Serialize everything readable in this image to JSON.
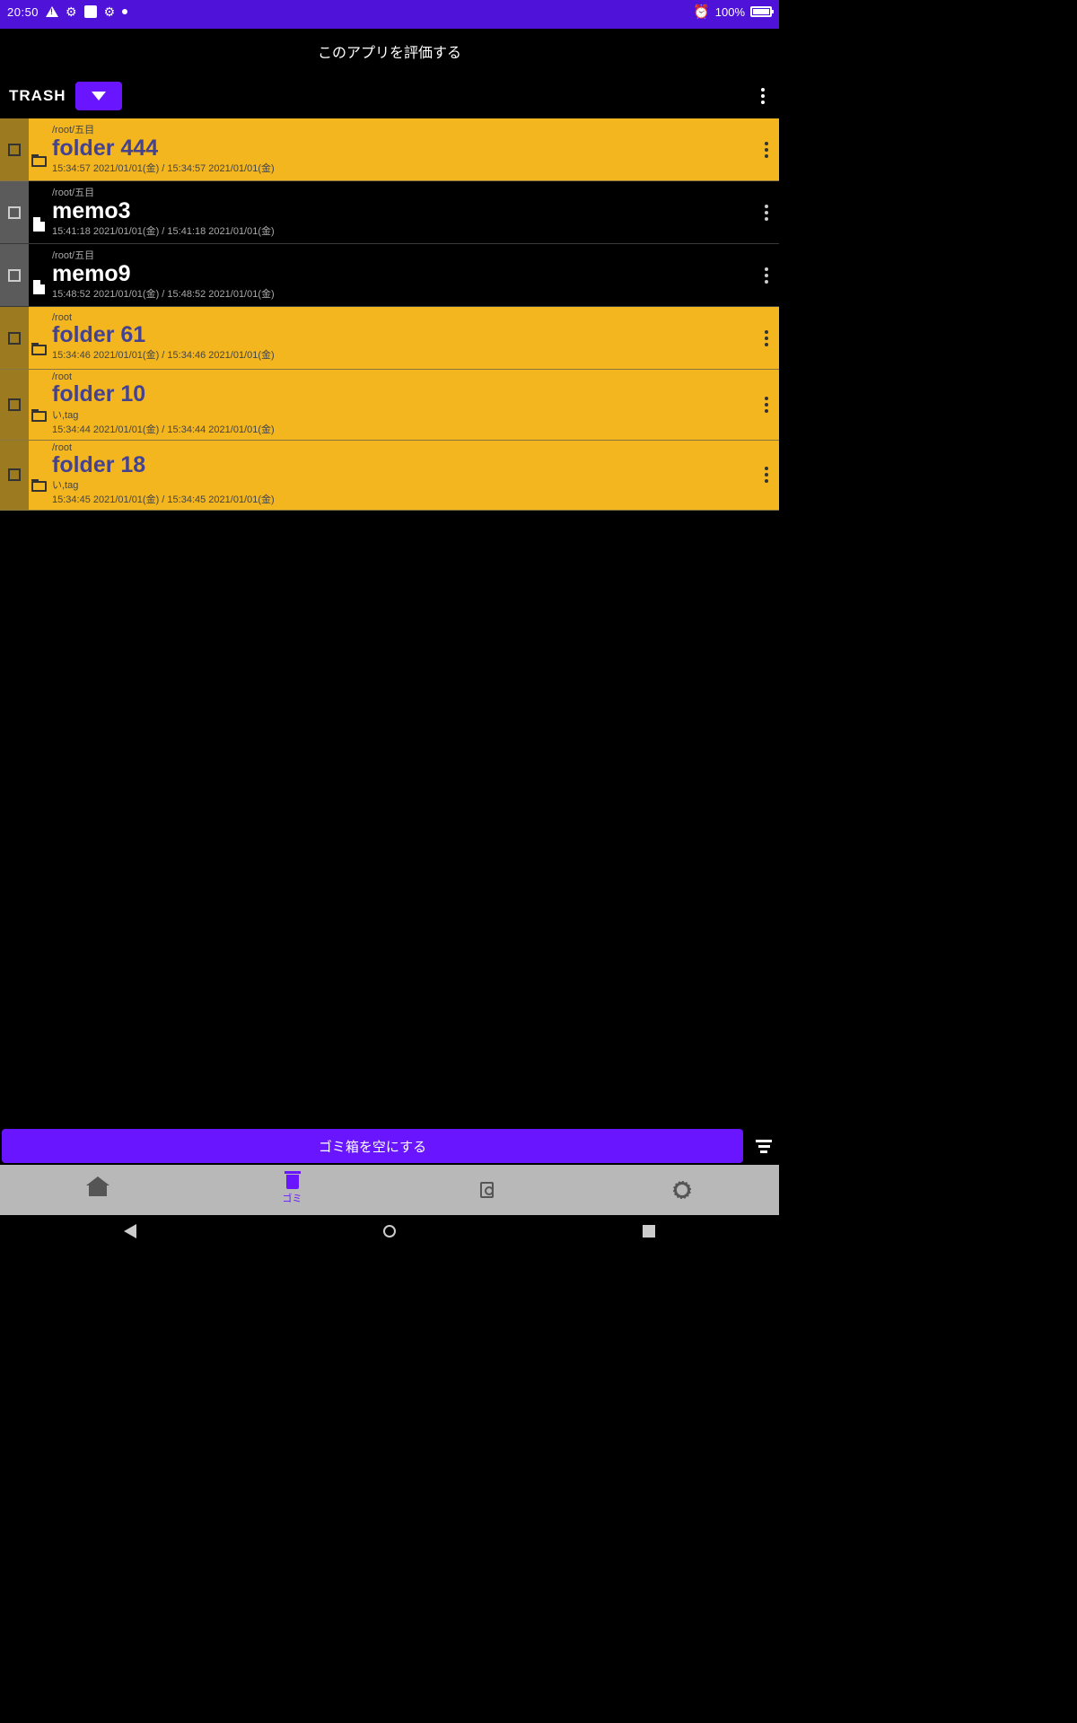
{
  "status": {
    "time": "20:50",
    "battery_pct": "100%"
  },
  "header": {
    "rate_label": "このアプリを評価する",
    "trash_label": "TRASH"
  },
  "items": [
    {
      "type": "folder",
      "path": "/root/五目",
      "title": "folder 444",
      "tags": "",
      "dates": "15:34:57  2021/01/01(金) / 15:34:57  2021/01/01(金)"
    },
    {
      "type": "file",
      "path": "/root/五目",
      "title": "memo3",
      "tags": "",
      "dates": "15:41:18  2021/01/01(金) / 15:41:18  2021/01/01(金)"
    },
    {
      "type": "file",
      "path": "/root/五目",
      "title": "memo9",
      "tags": "",
      "dates": "15:48:52  2021/01/01(金) / 15:48:52  2021/01/01(金)"
    },
    {
      "type": "folder",
      "path": "/root",
      "title": "folder 61",
      "tags": "",
      "dates": "15:34:46  2021/01/01(金) / 15:34:46  2021/01/01(金)"
    },
    {
      "type": "folder",
      "path": "/root",
      "title": "folder 10",
      "tags": "い,tag",
      "dates": "15:34:44  2021/01/01(金) / 15:34:44  2021/01/01(金)"
    },
    {
      "type": "folder",
      "path": "/root",
      "title": "folder 18",
      "tags": "い,tag",
      "dates": "15:34:45  2021/01/01(金) / 15:34:45  2021/01/01(金)"
    }
  ],
  "footer": {
    "empty_button": "ゴミ箱を空にする",
    "tab_trash_label": "ゴミ"
  }
}
